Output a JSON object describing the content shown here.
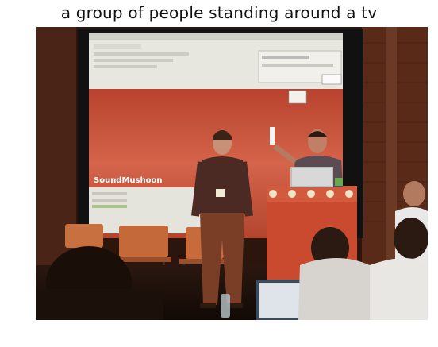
{
  "caption": "a group of people standing around a tv",
  "scene": {
    "screen_brand_text": "SoundMushoon",
    "colors": {
      "screen_red": "#c8543b",
      "screen_light": "#e7e6df",
      "wall_dark": "#2a140c",
      "podium": "#c94a2e",
      "chair": "#c86a3a"
    }
  }
}
